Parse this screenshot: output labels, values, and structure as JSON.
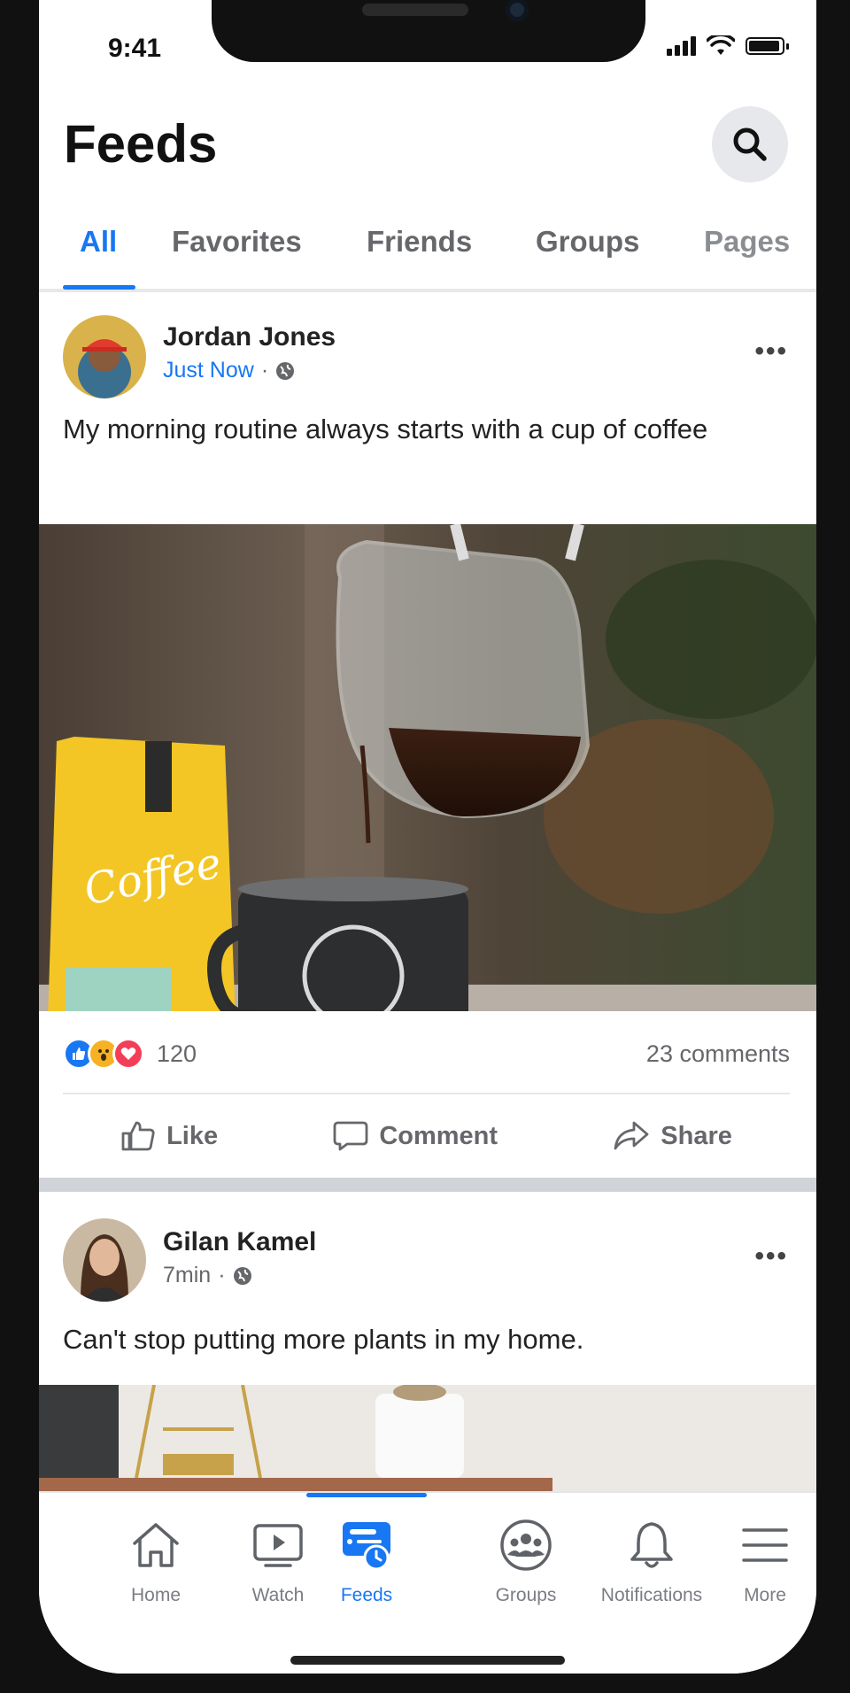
{
  "status_bar": {
    "time": "9:41"
  },
  "header": {
    "title": "Feeds"
  },
  "tabs": [
    {
      "label": "All",
      "active": true
    },
    {
      "label": "Favorites",
      "active": false
    },
    {
      "label": "Friends",
      "active": false
    },
    {
      "label": "Groups",
      "active": false
    },
    {
      "label": "Pages",
      "active": false
    }
  ],
  "posts": [
    {
      "author": "Jordan Jones",
      "time": "Just Now",
      "privacy_icon": "globe-icon",
      "text": "My morning routine always starts with a cup of coffee",
      "reactions": [
        "like",
        "wow",
        "love"
      ],
      "reaction_count": "120",
      "comments": "23 comments",
      "actions": {
        "like": "Like",
        "comment": "Comment",
        "share": "Share"
      }
    },
    {
      "author": "Gilan Kamel",
      "time": "7min",
      "privacy_icon": "globe-icon",
      "text": "Can't stop putting more plants in my home."
    }
  ],
  "bottom_nav": [
    {
      "label": "Home",
      "icon": "home-icon",
      "active": false
    },
    {
      "label": "Watch",
      "icon": "watch-icon",
      "active": false
    },
    {
      "label": "Feeds",
      "icon": "feeds-icon",
      "active": true
    },
    {
      "label": "Groups",
      "icon": "groups-icon",
      "active": false
    },
    {
      "label": "Notifications",
      "icon": "bell-icon",
      "active": false
    },
    {
      "label": "More",
      "icon": "menu-icon",
      "active": false
    }
  ],
  "colors": {
    "accent": "#1877f2",
    "text_secondary": "#65676b",
    "love": "#f33e58",
    "wow": "#f7b125"
  }
}
